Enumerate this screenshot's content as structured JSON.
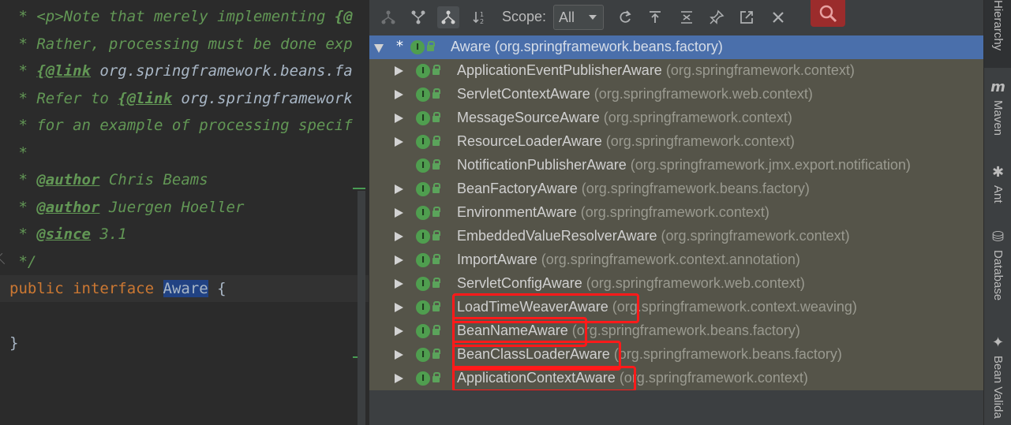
{
  "editor": {
    "lines": [
      {
        "a": " * ",
        "b": "<p>",
        "c": "Note that merely implementing ",
        "d": "{@"
      },
      {
        "a": " * Rather, processing must be done exp"
      },
      {
        "a": " * ",
        "b": "{@link",
        "c": " org.springframework.beans.fa"
      },
      {
        "a": " * Refer to ",
        "b": "{@link",
        "c": " org.springframework"
      },
      {
        "a": " * for an example of processing specif"
      },
      {
        "a": " *"
      },
      {
        "a": " * ",
        "b": "@author",
        "c": " Chris Beams"
      },
      {
        "a": " * ",
        "b": "@author",
        "c": " Juergen Hoeller"
      },
      {
        "a": " * ",
        "b": "@since",
        "c": " 3.1"
      },
      {
        "a": " */"
      },
      {
        "kw1": "public",
        "kw2": "interface",
        "name": "Aware",
        "brace": "{"
      },
      {
        "a": ""
      },
      {
        "a": "}"
      }
    ]
  },
  "toolbar": {
    "scope_label": "Scope:",
    "scope_value": "All",
    "search_icon": "search-icon"
  },
  "tree": {
    "root": {
      "name": "Aware",
      "package": "(org.springframework.beans.factory)",
      "marker": "*"
    },
    "children": [
      {
        "name": "ApplicationEventPublisherAware",
        "package": "(org.springframework.context)",
        "expandable": true
      },
      {
        "name": "ServletContextAware",
        "package": "(org.springframework.web.context)",
        "expandable": true
      },
      {
        "name": "MessageSourceAware",
        "package": "(org.springframework.context)",
        "expandable": true
      },
      {
        "name": "ResourceLoaderAware",
        "package": "(org.springframework.context)",
        "expandable": true
      },
      {
        "name": "NotificationPublisherAware",
        "package": "(org.springframework.jmx.export.notification)",
        "expandable": false
      },
      {
        "name": "BeanFactoryAware",
        "package": "(org.springframework.beans.factory)",
        "expandable": true
      },
      {
        "name": "EnvironmentAware",
        "package": "(org.springframework.context)",
        "expandable": true
      },
      {
        "name": "EmbeddedValueResolverAware",
        "package": "(org.springframework.context)",
        "expandable": true
      },
      {
        "name": "ImportAware",
        "package": "(org.springframework.context.annotation)",
        "expandable": true
      },
      {
        "name": "ServletConfigAware",
        "package": "(org.springframework.web.context)",
        "expandable": true
      },
      {
        "name": "LoadTimeWeaverAware",
        "package": "(org.springframework.context.weaving)",
        "expandable": true
      },
      {
        "name": "BeanNameAware",
        "package": "(org.springframework.beans.factory)",
        "expandable": true
      },
      {
        "name": "BeanClassLoaderAware",
        "package": "(org.springframework.beans.factory)",
        "expandable": true
      },
      {
        "name": "ApplicationContextAware",
        "package": "(org.springframework.context)",
        "expandable": true
      }
    ],
    "badge_letter": "I"
  },
  "stripe": {
    "tabs": [
      {
        "label": "Hierarchy",
        "icon": ""
      },
      {
        "label": "Maven",
        "icon": "m"
      },
      {
        "label": "Ant",
        "icon": "✱"
      },
      {
        "label": "Database",
        "icon": "⛁"
      },
      {
        "label": "Bean Valida",
        "icon": "✦"
      }
    ]
  },
  "colors": {
    "highlight_box": "#ff1a1a",
    "selected_row": "#4a6fab",
    "tree_background": "#555449"
  }
}
